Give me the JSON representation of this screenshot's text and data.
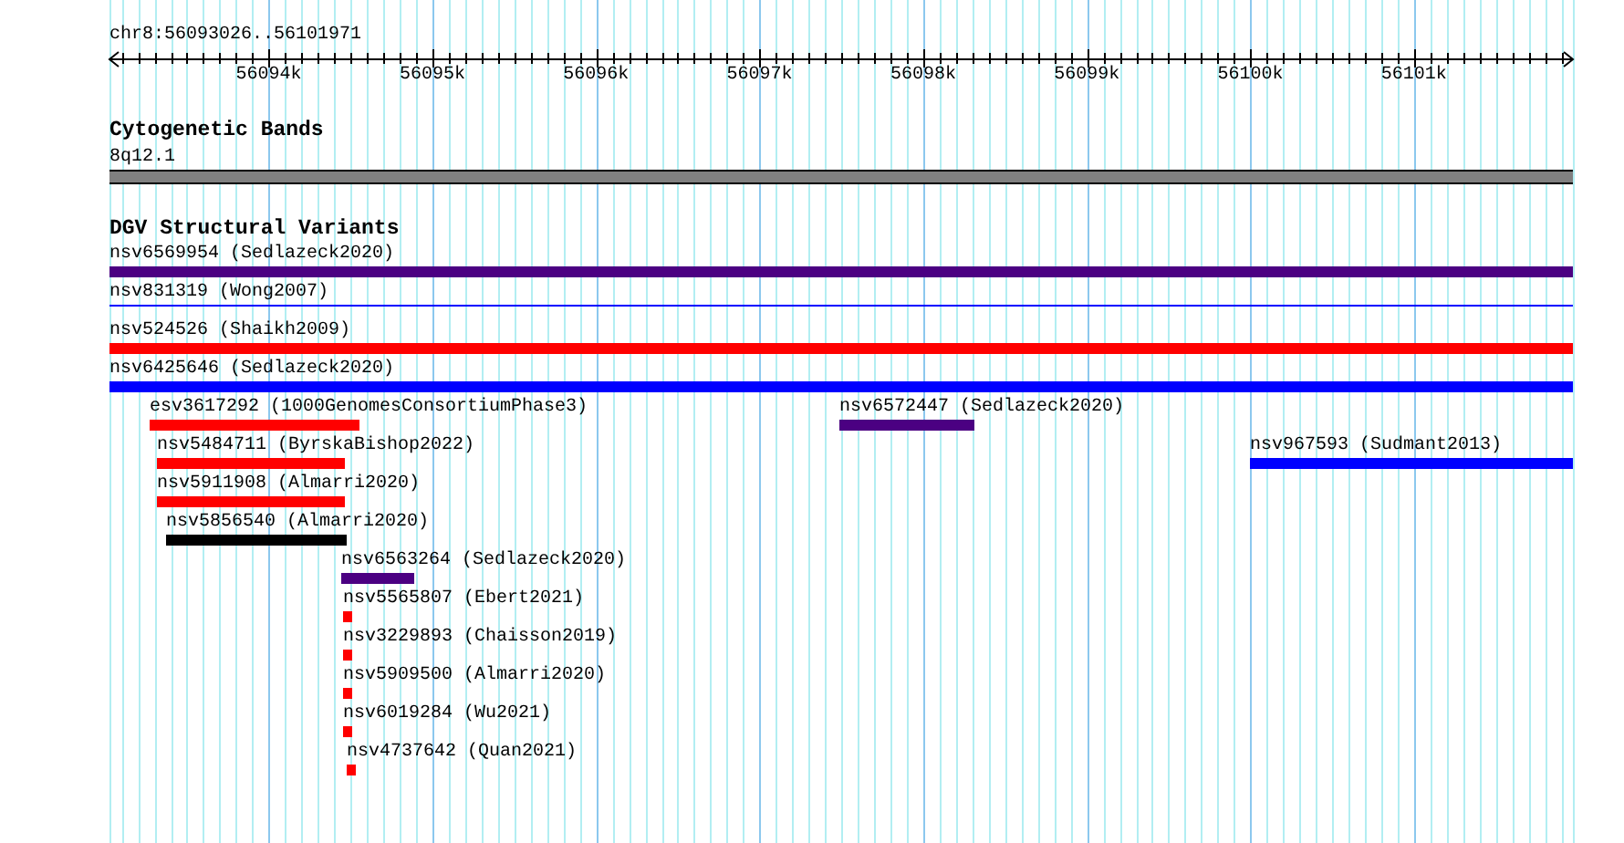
{
  "view": {
    "location": "chr8:56093026..56101971"
  },
  "ruler": {
    "ticks": [
      "56094k",
      "56095k",
      "56096k",
      "56097k",
      "56098k",
      "56099k",
      "56100k",
      "56101k"
    ]
  },
  "tracks": [
    {
      "title": "Cytogenetic Bands",
      "kind": "band",
      "rows": [
        [
          {
            "label": "8q12.1",
            "color": "#808080",
            "kind": "band"
          }
        ]
      ]
    },
    {
      "title": "DGV Structural Variants",
      "kind": "features",
      "rows": [
        [
          {
            "label": "nsv6569954 (Sedlazeck2020)",
            "color": "#4b0082",
            "kind": "bar"
          }
        ],
        [
          {
            "label": "nsv831319 (Wong2007)",
            "color": "#0000ff",
            "kind": "line"
          }
        ],
        [
          {
            "label": "nsv524526 (Shaikh2009)",
            "color": "#ff0000",
            "kind": "bar"
          }
        ],
        [
          {
            "label": "nsv6425646 (Sedlazeck2020)",
            "color": "#0000ff",
            "kind": "bar"
          }
        ],
        [
          {
            "label": "esv3617292 (1000GenomesConsortiumPhase3)",
            "color": "#ff0000",
            "kind": "bar"
          },
          {
            "label": "nsv6572447 (Sedlazeck2020)",
            "color": "#4b0082",
            "kind": "bar"
          }
        ],
        [
          {
            "label": "nsv5484711 (ByrskaBishop2022)",
            "color": "#ff0000",
            "kind": "bar"
          },
          {
            "label": "nsv967593 (Sudmant2013)",
            "color": "#0000ff",
            "kind": "bar"
          }
        ],
        [
          {
            "label": "nsv5911908 (Almarri2020)",
            "color": "#ff0000",
            "kind": "bar"
          }
        ],
        [
          {
            "label": "nsv5856540 (Almarri2020)",
            "color": "#000000",
            "kind": "bar"
          }
        ],
        [
          {
            "label": "nsv6563264 (Sedlazeck2020)",
            "color": "#4b0082",
            "kind": "bar"
          }
        ],
        [
          {
            "label": "nsv5565807 (Ebert2021)",
            "color": "#ff0000",
            "kind": "bar"
          }
        ],
        [
          {
            "label": "nsv3229893 (Chaisson2019)",
            "color": "#ff0000",
            "kind": "bar"
          }
        ],
        [
          {
            "label": "nsv5909500 (Almarri2020)",
            "color": "#ff0000",
            "kind": "bar"
          }
        ],
        [
          {
            "label": "nsv6019284 (Wu2021)",
            "color": "#ff0000",
            "kind": "bar"
          }
        ],
        [
          {
            "label": "nsv4737642 (Quan2021)",
            "color": "#ff0000",
            "kind": "bar"
          }
        ]
      ]
    }
  ]
}
